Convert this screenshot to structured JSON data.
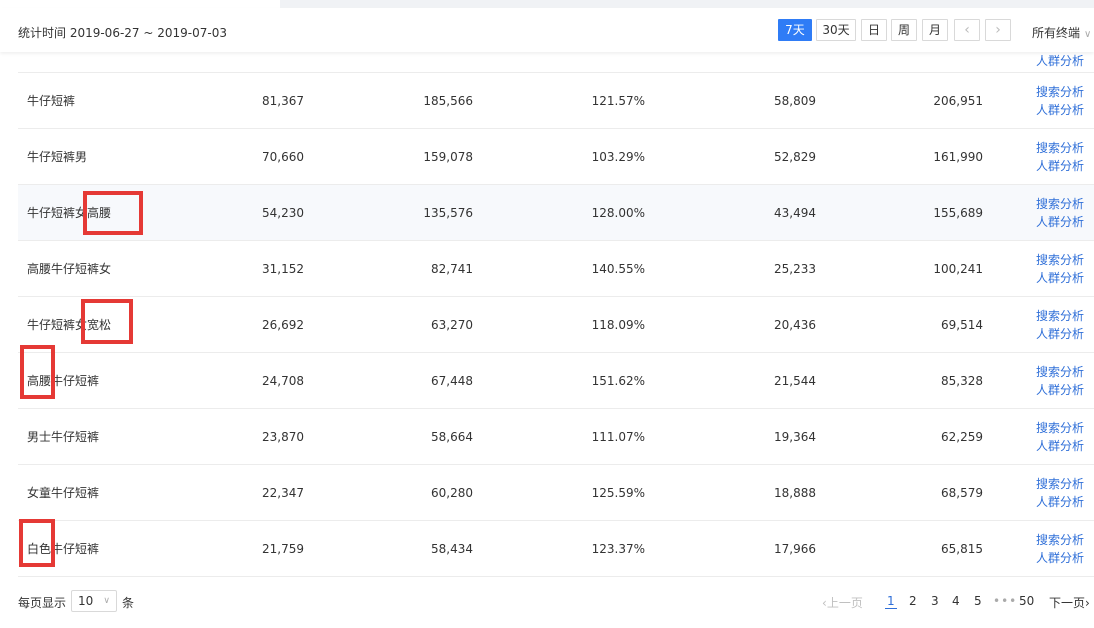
{
  "toolbar": {
    "period_label": "统计时间 2019-06-27 ~ 2019-07-03",
    "buttons": [
      "7天",
      "30天",
      "日",
      "周",
      "月"
    ],
    "active_button": "7天",
    "terminal": "所有终端"
  },
  "rows": [
    {
      "keyword": "牛仔短裤",
      "v1": "81,367",
      "v2": "185,566",
      "v3": "121.57%",
      "v4": "58,809",
      "v5": "206,951"
    },
    {
      "keyword": "牛仔短裤男",
      "v1": "70,660",
      "v2": "159,078",
      "v3": "103.29%",
      "v4": "52,829",
      "v5": "161,990"
    },
    {
      "keyword": "牛仔短裤女高腰",
      "v1": "54,230",
      "v2": "135,576",
      "v3": "128.00%",
      "v4": "43,494",
      "v5": "155,689"
    },
    {
      "keyword": "高腰牛仔短裤女",
      "v1": "31,152",
      "v2": "82,741",
      "v3": "140.55%",
      "v4": "25,233",
      "v5": "100,241"
    },
    {
      "keyword": "牛仔短裤女宽松",
      "v1": "26,692",
      "v2": "63,270",
      "v3": "118.09%",
      "v4": "20,436",
      "v5": "69,514"
    },
    {
      "keyword": "高腰牛仔短裤",
      "v1": "24,708",
      "v2": "67,448",
      "v3": "151.62%",
      "v4": "21,544",
      "v5": "85,328"
    },
    {
      "keyword": "男士牛仔短裤",
      "v1": "23,870",
      "v2": "58,664",
      "v3": "111.07%",
      "v4": "19,364",
      "v5": "62,259"
    },
    {
      "keyword": "女童牛仔短裤",
      "v1": "22,347",
      "v2": "60,280",
      "v3": "125.59%",
      "v4": "18,888",
      "v5": "68,579"
    },
    {
      "keyword": "白色牛仔短裤",
      "v1": "21,759",
      "v2": "58,434",
      "v3": "123.37%",
      "v4": "17,966",
      "v5": "65,815"
    }
  ],
  "row_links": {
    "search": "搜索分析",
    "crowd": "人群分析"
  },
  "partial_row_link": "人群分析",
  "pagination": {
    "per_page_label": "每页显示",
    "per_page_value": "10",
    "unit_label": "条",
    "prev": "上一页",
    "pages": [
      "1",
      "2",
      "3",
      "4",
      "5"
    ],
    "current_page": "1",
    "ellipsis": "•••",
    "last_page": "50",
    "next": "下一页"
  },
  "colors": {
    "accent": "#2f7cf6",
    "link": "#2f6fd8",
    "annotation": "#e53935"
  }
}
